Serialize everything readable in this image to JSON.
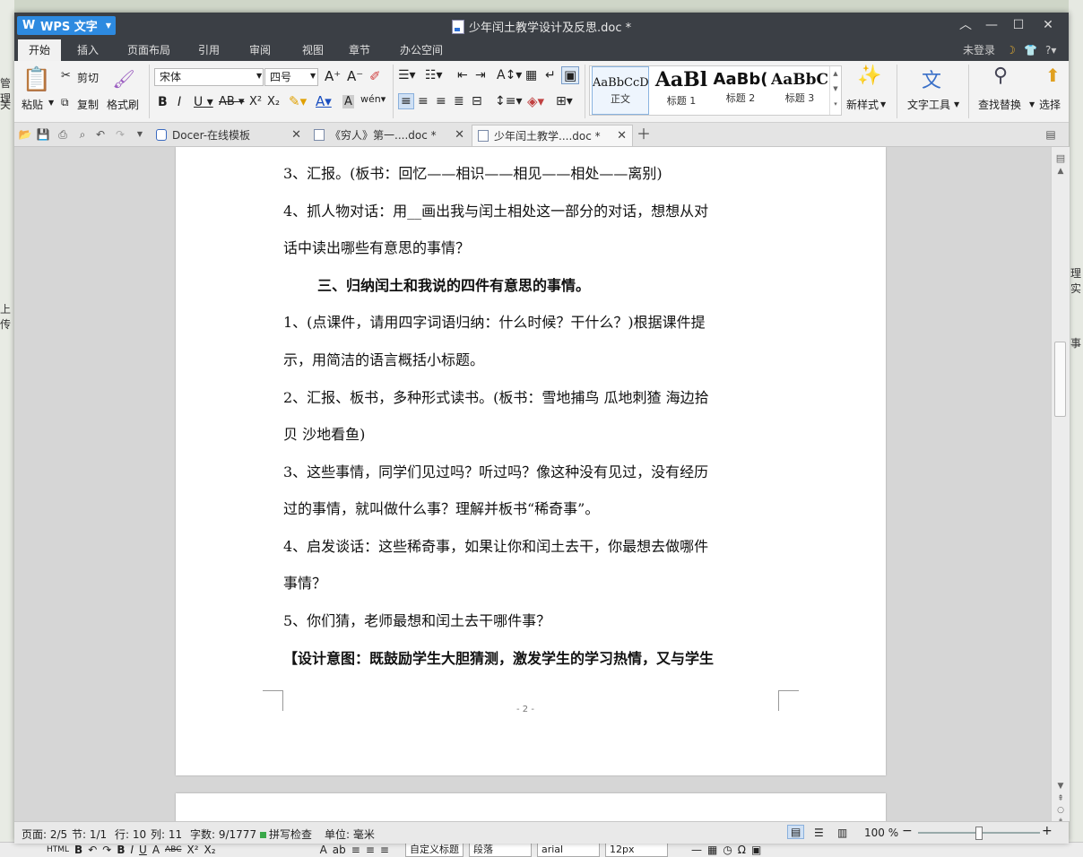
{
  "background": {
    "left_fragments": [
      "管理",
      "关",
      "上传"
    ],
    "right_fragments": [
      "理实",
      "事"
    ],
    "bottom_toolbar": {
      "style_select": "自定义标题",
      "para_select": "段落",
      "font_select": "arial",
      "size_select": "12px"
    }
  },
  "window": {
    "app_name": "WPS 文字",
    "doc_title": "少年闰土教学设计及反思.doc *",
    "menu": [
      "开始",
      "插入",
      "页面布局",
      "引用",
      "审阅",
      "视图",
      "章节",
      "办公空间"
    ],
    "login": "未登录"
  },
  "toolbar": {
    "paste": "粘贴",
    "cut": "剪切",
    "copy": "复制",
    "format_painter": "格式刷",
    "font_name": "宋体",
    "font_size": "四号",
    "styles": [
      {
        "preview": "AaBbCcDd",
        "label": "正文"
      },
      {
        "preview": "AaBl",
        "label": "标题 1"
      },
      {
        "preview": "AaBb(",
        "label": "标题 2"
      },
      {
        "preview": "AaBbC",
        "label": "标题 3"
      }
    ],
    "new_style": "新样式",
    "text_tools": "文字工具",
    "find_replace": "查找替换",
    "select": "选择"
  },
  "tabs": [
    {
      "label": "Docer-在线模板"
    },
    {
      "label": "《穷人》第一....doc *"
    },
    {
      "label": "少年闰土教学....doc *"
    }
  ],
  "document": {
    "paragraphs": [
      "3、汇报。(板书：回忆——相识——相见——相处——离别)",
      "4、抓人物对话：用__画出我与闰土相处这一部分的对话，想想从对",
      "话中读出哪些有意思的事情？",
      "三、归纳闰土和我说的四件有意思的事情。",
      "1、(点课件，请用四字词语归纳：什么时候？干什么？)根据课件提",
      "示，用简洁的语言概括小标题。",
      "2、汇报、板书，多种形式读书。(板书：雪地捕鸟 瓜地刺猹 海边拾",
      "贝 沙地看鱼)",
      "3、这些事情，同学们见过吗？听过吗？像这种没有见过，没有经历",
      "过的事情，就叫做什么事？理解并板书“稀奇事”。",
      "4、启发谈话：这些稀奇事，如果让你和闰土去干，你最想去做哪件",
      "事情？",
      "5、你们猜，老师最想和闰土去干哪件事？",
      "【设计意图：既鼓励学生大胆猜测，激发学生的学习热情，又与学生"
    ],
    "page_number": "- 2 -"
  },
  "status": {
    "page": "页面: 2/5",
    "section": "节: 1/1",
    "row": "行: 10",
    "col": "列: 11",
    "words": "字数: 9/1777",
    "spell": "拼写检查",
    "unit": "单位: 毫米",
    "zoom": "100 %"
  }
}
